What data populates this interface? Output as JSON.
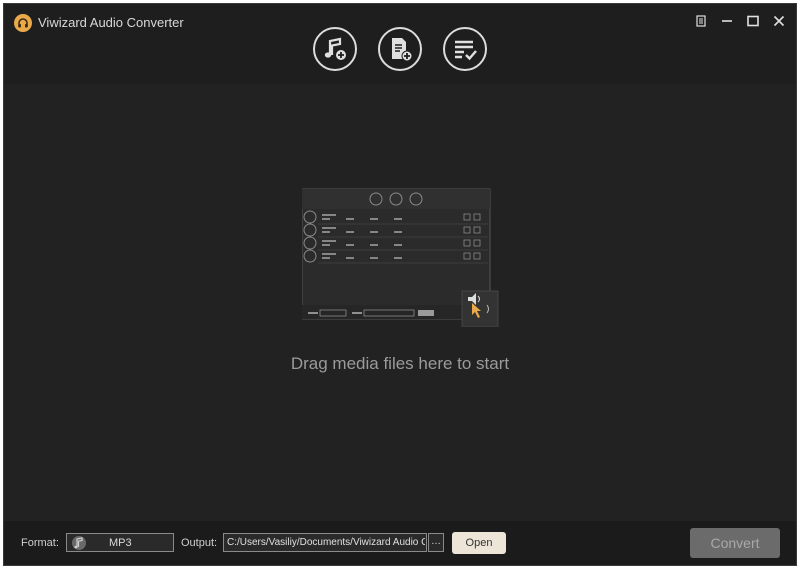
{
  "window": {
    "title": "Viwizard Audio Converter"
  },
  "toolbar": {
    "add_music_icon": "music-add-icon",
    "add_file_icon": "file-add-icon",
    "converted_list_icon": "list-check-icon"
  },
  "window_controls": {
    "menu_icon": "menu-icon",
    "minimize_icon": "minimize-icon",
    "maximize_icon": "maximize-icon",
    "close_icon": "close-icon"
  },
  "main": {
    "drop_hint": "Drag media files here to start"
  },
  "bottom": {
    "format_label": "Format:",
    "format_value": "MP3",
    "output_label": "Output:",
    "output_path": "C:/Users/Vasiliy/Documents/Viwizard Audio Converter",
    "browse_label": "…",
    "open_label": "Open",
    "convert_label": "Convert"
  },
  "colors": {
    "accent": "#e9a94a",
    "background": "#222222",
    "titlebar": "#1e1e1e"
  }
}
